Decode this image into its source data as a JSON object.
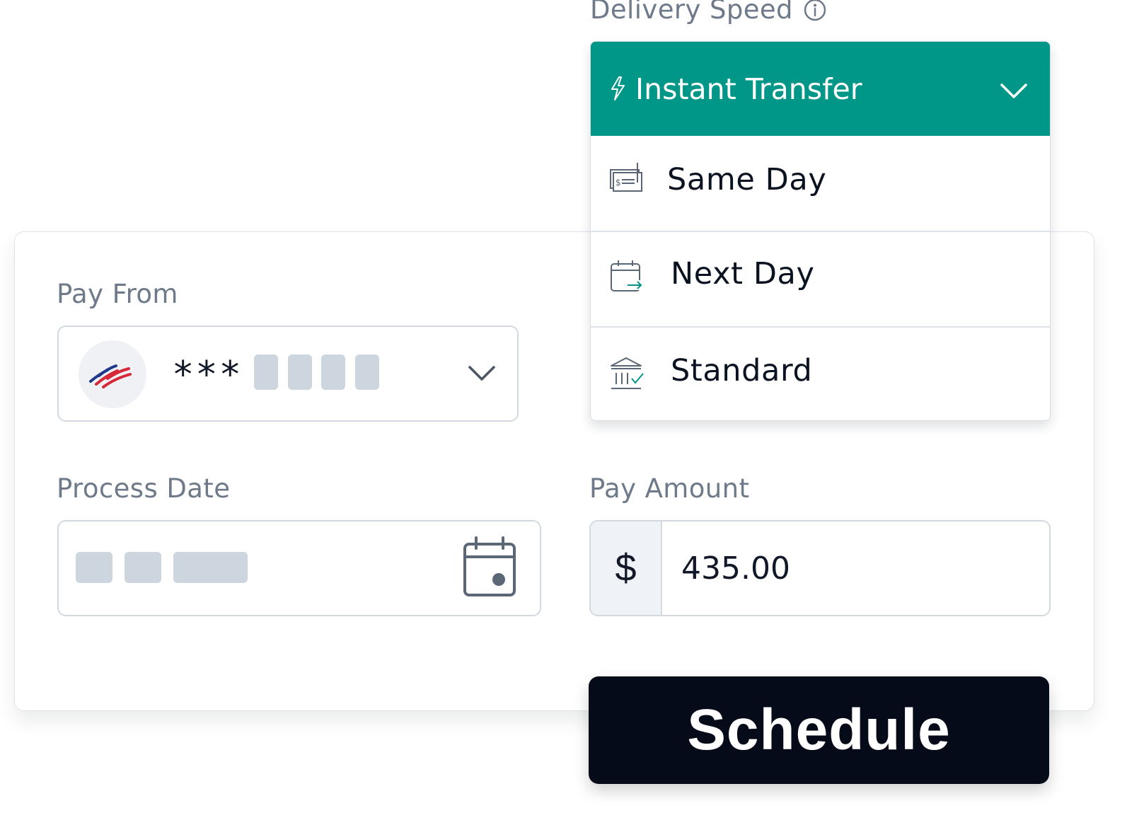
{
  "delivery_speed": {
    "label": "Delivery Speed",
    "info_icon": "info-icon",
    "selected": "Instant Transfer",
    "selected_icon": "lightning-bolt-icon",
    "options": [
      {
        "label": "Same Day",
        "icon": "check-payment-icon"
      },
      {
        "label": "Next Day",
        "icon": "calendar-arrow-icon"
      },
      {
        "label": "Standard",
        "icon": "bank-check-icon"
      }
    ],
    "accent_color": "#009688"
  },
  "pay_from": {
    "label": "Pay From",
    "masked_prefix": "***",
    "bank_logo": "bank-flag-logo"
  },
  "process_date": {
    "label": "Process Date",
    "icon": "calendar-icon"
  },
  "pay_amount": {
    "label": "Pay Amount",
    "currency_symbol": "$",
    "value": "435.00"
  },
  "schedule_button": {
    "label": "Schedule"
  }
}
